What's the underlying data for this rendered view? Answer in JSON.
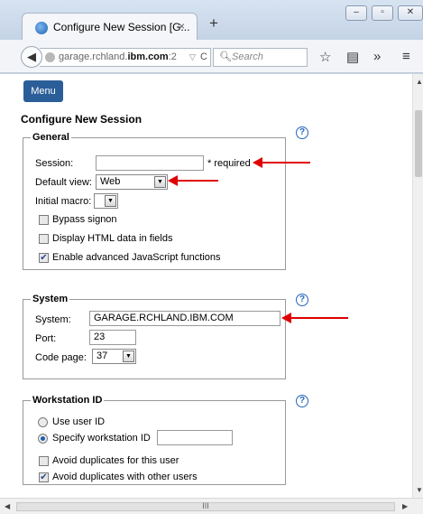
{
  "browser": {
    "tab_title": "Configure New Session [G...",
    "tab_close": "×",
    "new_tab": "+",
    "url_host_pre": "garage.rchland.",
    "url_host_bold": "ibm.com",
    "url_host_post": ":2",
    "search_placeholder": "Search",
    "window_buttons": {
      "minimize": "‒",
      "maximize": "▫",
      "close": "✕"
    },
    "icons": [
      "back-arrow-icon",
      "globe-icon",
      "reload-icon",
      "search-icon",
      "bookmark-star-icon",
      "reading-list-icon",
      "overflow-chevron-icon",
      "hamburger-menu-icon"
    ]
  },
  "page": {
    "menu_label": "Menu",
    "title": "Configure New Session"
  },
  "general": {
    "legend": "General",
    "session_label": "Session:",
    "session_value": "",
    "required_text": "* required",
    "default_view_label": "Default view:",
    "default_view_value": "Web",
    "initial_macro_label": "Initial macro:",
    "initial_macro_value": "",
    "bypass_signon": {
      "label": "Bypass signon",
      "checked": false
    },
    "display_html": {
      "label": "Display HTML data in fields",
      "checked": false
    },
    "enable_js": {
      "label": "Enable advanced JavaScript functions",
      "checked": true
    }
  },
  "system": {
    "legend": "System",
    "system_label": "System:",
    "system_value": "GARAGE.RCHLAND.IBM.COM",
    "port_label": "Port:",
    "port_value": "23",
    "code_page_label": "Code page:",
    "code_page_value": "37"
  },
  "workstation": {
    "legend": "Workstation ID",
    "use_user_id": {
      "label": "Use user ID",
      "selected": false
    },
    "specify_ws_id": {
      "label": "Specify workstation ID",
      "selected": true
    },
    "ws_id_value": "",
    "avoid_dup_user": {
      "label": "Avoid duplicates for this user",
      "checked": false
    },
    "avoid_dup_others": {
      "label": "Avoid duplicates with other users",
      "checked": true
    }
  },
  "help_glyph": "?",
  "scroll_grip": "III",
  "colors": {
    "accent": "#2a5e98",
    "annotation_arrow": "#e00000",
    "help_icon": "#2266bb"
  }
}
